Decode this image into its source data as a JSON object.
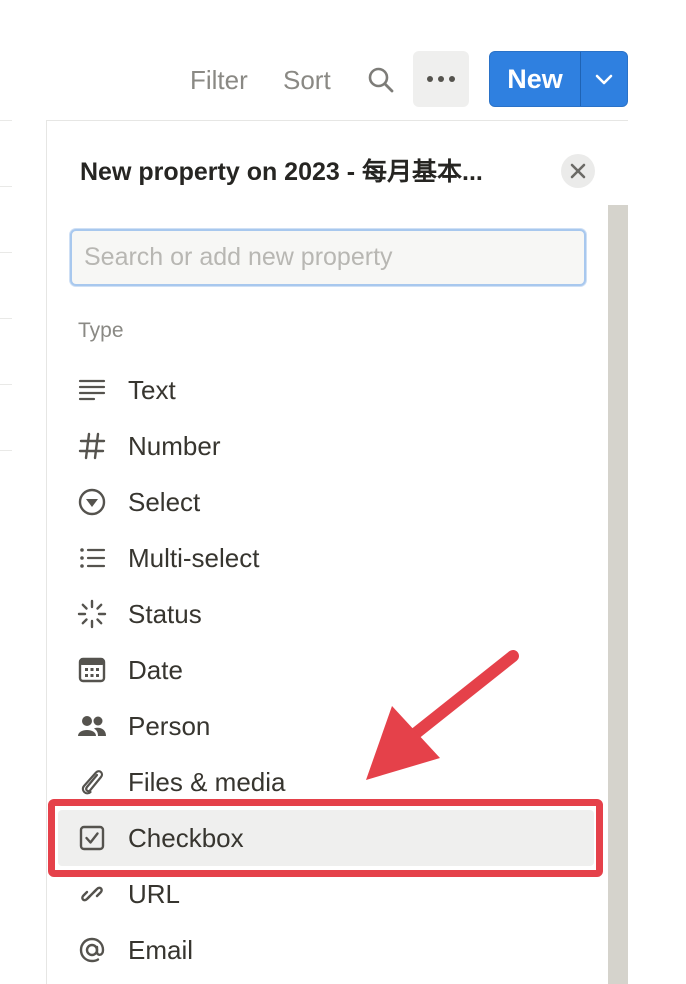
{
  "toolbar": {
    "filter_label": "Filter",
    "sort_label": "Sort",
    "search_icon": "search-icon",
    "more_icon": "more-horizontal-icon",
    "new_label": "New",
    "new_dropdown_icon": "chevron-down-icon"
  },
  "panel": {
    "title": "New property on 2023 - 每月基本...",
    "close_icon": "close-icon",
    "search": {
      "value": "",
      "placeholder": "Search or add new property"
    },
    "section_label": "Type",
    "types": [
      {
        "label": "Text",
        "icon": "text-lines-icon"
      },
      {
        "label": "Number",
        "icon": "hash-icon"
      },
      {
        "label": "Select",
        "icon": "select-circle-icon"
      },
      {
        "label": "Multi-select",
        "icon": "list-icon"
      },
      {
        "label": "Status",
        "icon": "status-spinner-icon"
      },
      {
        "label": "Date",
        "icon": "calendar-icon"
      },
      {
        "label": "Person",
        "icon": "people-icon"
      },
      {
        "label": "Files & media",
        "icon": "paperclip-icon"
      },
      {
        "label": "Checkbox",
        "icon": "checkbox-icon",
        "highlighted": true
      },
      {
        "label": "URL",
        "icon": "link-icon"
      },
      {
        "label": "Email",
        "icon": "at-icon"
      }
    ]
  },
  "colors": {
    "accent_blue": "#2f80e0",
    "annotation_red": "#e5414a",
    "text_primary": "#37352f",
    "text_muted": "#8a8984"
  }
}
